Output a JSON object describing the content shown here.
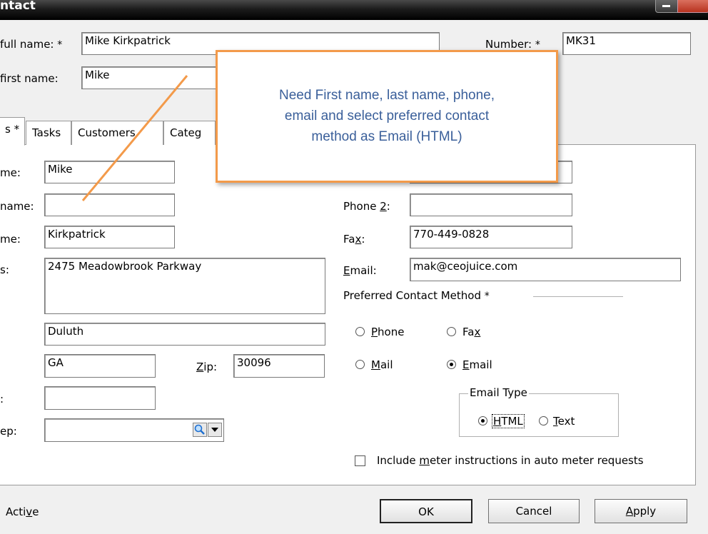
{
  "window": {
    "title": "ntact"
  },
  "header": {
    "full_name_label": "full name:",
    "full_name_value": "Mike Kirkpatrick",
    "first_name_label": "first name:",
    "first_name_value": "Mike",
    "number_label": "Number:",
    "number_value": "MK31",
    "required_mark": "*"
  },
  "tabs": [
    {
      "label": "s *"
    },
    {
      "label": "Tasks"
    },
    {
      "label": "Customers"
    },
    {
      "label": "Categ"
    }
  ],
  "form": {
    "first_label": "me:",
    "first_value": "Mike",
    "middle_label": "name:",
    "middle_value": "",
    "last_label": "me:",
    "last_value": "Kirkpatrick",
    "address_label": "s:",
    "address_value": "2475 Meadowbrook Parkway",
    "city_value": "Duluth",
    "state_value": "GA",
    "zip_label": "Zip:",
    "zip_value": "30096",
    "county_label": ":",
    "county_value": "",
    "rep_label": "ep:",
    "rep_value": "",
    "phone2_label": "Phone 2:",
    "phone2_value": "",
    "fax_label": "Fax:",
    "fax_value": "770-449-0828",
    "email_label": "Email:",
    "email_value": "mak@ceojuice.com",
    "preferred_label": "Preferred Contact Method",
    "contact_methods": [
      {
        "label": "Phone",
        "selected": false
      },
      {
        "label": "Fax",
        "selected": false
      },
      {
        "label": "Mail",
        "selected": false
      },
      {
        "label": "Email",
        "selected": true
      }
    ],
    "email_type_label": "Email Type",
    "email_types": [
      {
        "label": "HTML",
        "selected": true
      },
      {
        "label": "Text",
        "selected": false
      }
    ],
    "meter_label": "Include meter instructions in auto meter requests",
    "meter_checked": false
  },
  "footer": {
    "active_label": "Active",
    "ok_label": "OK",
    "cancel_label": "Cancel",
    "apply_label": "Apply"
  },
  "callout": {
    "lines": [
      "Need First name, last name, phone,",
      "email and select preferred contact",
      "method as Email (HTML)"
    ]
  },
  "colors": {
    "callout_border": "#f39a4a",
    "callout_text": "#3a5f9a",
    "pointer_line": "#f39a4a"
  }
}
